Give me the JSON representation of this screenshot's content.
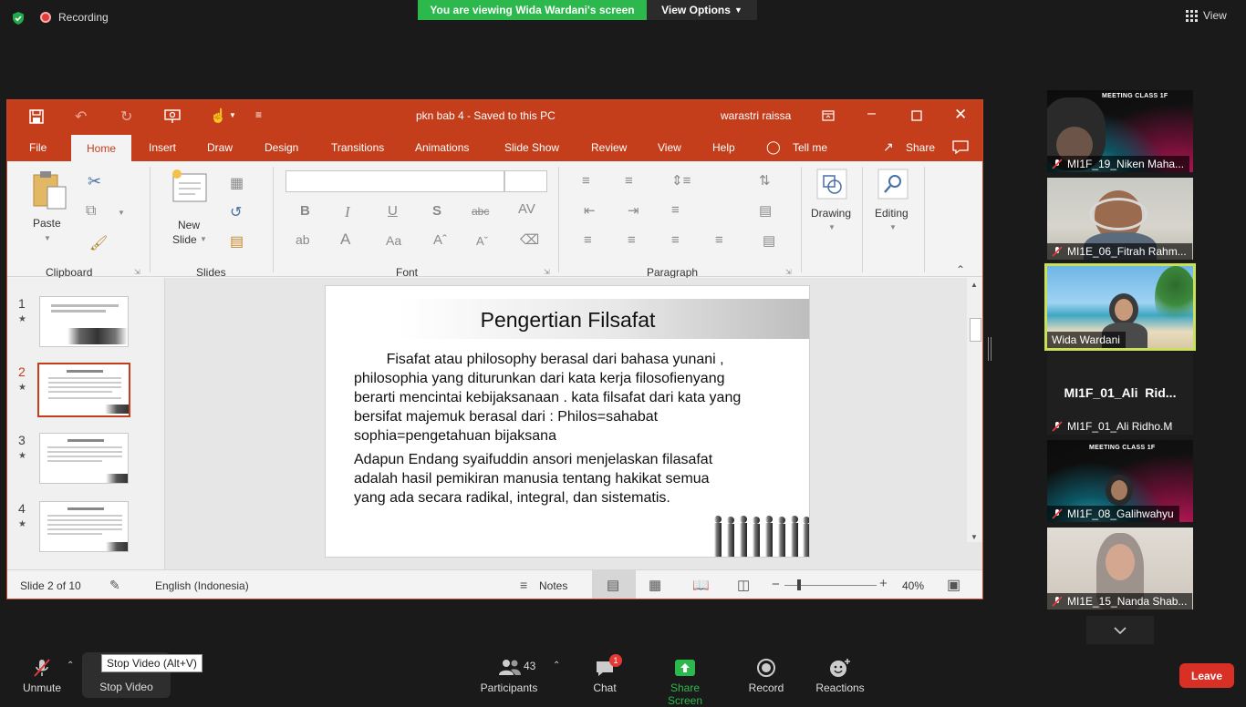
{
  "zoom": {
    "recording_label": "Recording",
    "viewing_banner": "You are viewing Wida Wardani's screen",
    "view_options_label": "View Options",
    "view_label": "View",
    "participants": [
      {
        "name": "MI1F_19_Niken Maha...",
        "muted": true,
        "bg": "meeting"
      },
      {
        "name": "MI1E_06_Fitrah Rahm...",
        "muted": true,
        "bg": "camera"
      },
      {
        "name": "Wida Wardani",
        "muted": false,
        "bg": "beach",
        "active_speaker": true
      },
      {
        "name": "MI1F_01_Ali Ridho.M",
        "muted": true,
        "bg": "none",
        "display_name": "MI1F_01_Ali  Rid..."
      },
      {
        "name": "MI1F_08_Galihwahyu",
        "muted": true,
        "bg": "meeting"
      },
      {
        "name": "MI1E_15_Nanda Shab...",
        "muted": true,
        "bg": "camera"
      }
    ],
    "meeting_class_label": "MEETING CLASS 1F",
    "toolbar": {
      "unmute": "Unmute",
      "stop_video": "Stop Video",
      "stop_video_tooltip": "Stop Video (Alt+V)",
      "participants": "Participants",
      "participants_count": "43",
      "chat": "Chat",
      "chat_badge": "1",
      "share_screen": "Share Screen",
      "record": "Record",
      "reactions": "Reactions",
      "leave": "Leave"
    },
    "colors": {
      "green": "#2db84d",
      "leave_red": "#d93025",
      "active_border": "#c8e05a"
    }
  },
  "ppt": {
    "window_title": "pkn bab 4  -  Saved to this PC",
    "user": "warastri raissa",
    "tabs": [
      "File",
      "Home",
      "Insert",
      "Draw",
      "Design",
      "Transitions",
      "Animations",
      "Slide Show",
      "Review",
      "View",
      "Help",
      "Tell me",
      "Share"
    ],
    "active_tab": "Home",
    "ribbon": {
      "clipboard": "Clipboard",
      "paste": "Paste",
      "slides": "Slides",
      "new_slide_1": "New",
      "new_slide_2": "Slide",
      "font": "Font",
      "paragraph": "Paragraph",
      "drawing": "Drawing",
      "editing": "Editing"
    },
    "thumbnails": [
      "1",
      "2",
      "3",
      "4"
    ],
    "selected_slide": 2,
    "slide": {
      "title": "Pengertian Filsafat",
      "para1_lines": [
        "        Fisafat atau philosophy berasal dari bahasa yunani ,",
        "philosophia yang diturunkan dari kata kerja filosofienyang",
        "berarti mencintai kebijaksanaan . kata filsafat dari kata yang",
        "bersifat majemuk berasal dari : Philos=sahabat",
        "sophia=pengetahuan bijaksana"
      ],
      "para2_lines": [
        "Adapun Endang syaifuddin ansori menjelaskan filasafat",
        "adalah hasil pemikiran manusia tentang hakikat semua",
        "yang ada secara radikal, integral, dan sistematis."
      ]
    },
    "status": {
      "slide_of": "Slide 2 of 10",
      "language": "English (Indonesia)",
      "notes": "Notes",
      "zoom": "40%"
    },
    "colors": {
      "accent": "#c43e1c"
    }
  }
}
